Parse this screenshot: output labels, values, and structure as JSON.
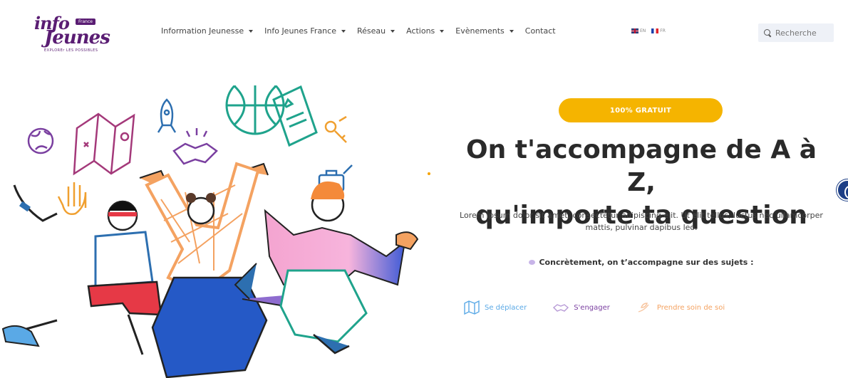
{
  "brand": {
    "logo_top": "info",
    "logo_main": "Jeunes",
    "logo_badge": "France",
    "tagline": "EXPLOREr LES POSSIBLES"
  },
  "nav": {
    "items": [
      {
        "label": "Information Jeunesse",
        "has_dropdown": true
      },
      {
        "label": "Info Jeunes France",
        "has_dropdown": true
      },
      {
        "label": "Réseau",
        "has_dropdown": true
      },
      {
        "label": "Actions",
        "has_dropdown": true
      },
      {
        "label": "Evènements",
        "has_dropdown": true
      },
      {
        "label": "Contact",
        "has_dropdown": false
      }
    ]
  },
  "languages": {
    "en": "EN",
    "fr": "FR"
  },
  "search": {
    "placeholder": "Recherche"
  },
  "hero": {
    "badge": "100% GRATUIT",
    "title_line1": "On t'accompagne de A à Z,",
    "title_line2": "qu'importe ta question",
    "description": "Lorem ipsum dolor sit amet, consectetur adipiscing elit. Ut elit tellus, luctus nec ullamcorper mattis, pulvinar dapibus leo.",
    "topics_intro": "Concrètement, on t’accompagne sur des sujets :",
    "topics": [
      {
        "label": "Se déplacer",
        "icon": "map-icon",
        "color": "#5aa9e6"
      },
      {
        "label": "S'engager",
        "icon": "handshake-icon",
        "color": "#7a3fa0"
      },
      {
        "label": "Prendre soin de soi",
        "icon": "care-icon",
        "color": "#f4a261"
      }
    ]
  },
  "colors": {
    "brand_purple": "#5a1d73",
    "badge_yellow": "#f5b400",
    "nav_text": "#444444",
    "search_bg": "#eef1f7"
  }
}
